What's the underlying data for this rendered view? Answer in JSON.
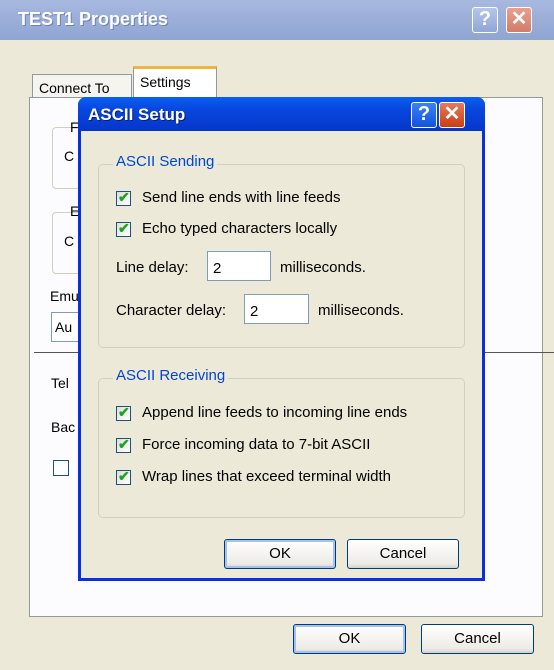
{
  "outer": {
    "title": "TEST1 Properties",
    "help_glyph": "?",
    "close_glyph": "✕",
    "tabs": [
      {
        "label": "Connect To"
      },
      {
        "label": "Settings"
      }
    ],
    "fragments": {
      "f1": "F",
      "radio1": "C",
      "e1": "E",
      "radio2": "C",
      "emu": "Emu",
      "au": "Au",
      "tel": "Tel",
      "bac": "Bac"
    },
    "ok_label": "OK",
    "cancel_label": "Cancel"
  },
  "dialog": {
    "title": "ASCII Setup",
    "help_glyph": "?",
    "close_glyph": "✕",
    "sending": {
      "legend": "ASCII Sending",
      "send_line_ends": {
        "label": "Send line ends with line feeds",
        "checked": true
      },
      "echo_typed": {
        "label": "Echo typed characters locally",
        "checked": true
      },
      "line_delay": {
        "label": "Line delay:",
        "value": "2",
        "unit": "milliseconds."
      },
      "char_delay": {
        "label": "Character delay:",
        "value": "2",
        "unit": "milliseconds."
      }
    },
    "receiving": {
      "legend": "ASCII Receiving",
      "append_lf": {
        "label": "Append line feeds to incoming line ends",
        "checked": true
      },
      "force_7bit": {
        "label": "Force incoming data to 7-bit ASCII",
        "checked": true
      },
      "wrap_lines": {
        "label": "Wrap lines that exceed terminal width",
        "checked": true
      }
    },
    "check_glyph": "✔",
    "ok_label": "OK",
    "cancel_label": "Cancel"
  }
}
